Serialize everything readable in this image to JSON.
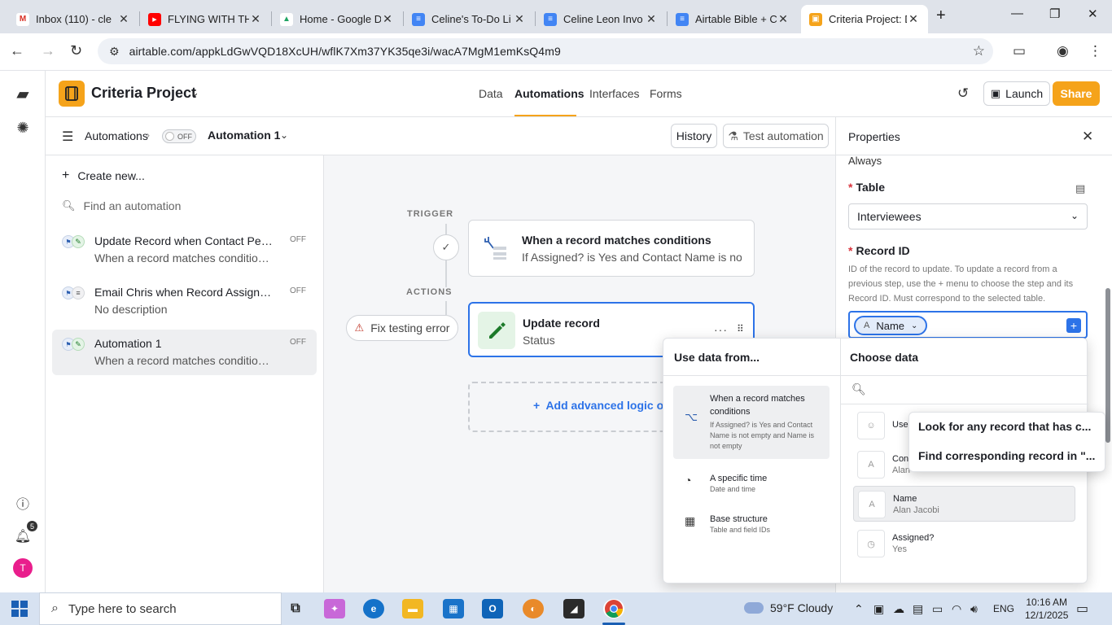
{
  "browser": {
    "tabs": [
      {
        "title": "Inbox (110) - cle",
        "favicon_color": "#d93025",
        "favicon_letter": "M"
      },
      {
        "title": "FLYING WITH TH",
        "favicon_color": "#ff0000",
        "favicon_letter": "▶"
      },
      {
        "title": "Home - Google D",
        "favicon_color": "#1fa463",
        "favicon_letter": "▲"
      },
      {
        "title": "Celine's To-Do Li",
        "favicon_color": "#4285f4",
        "favicon_letter": "≡"
      },
      {
        "title": "Celine Leon Invo",
        "favicon_color": "#4285f4",
        "favicon_letter": "≡"
      },
      {
        "title": "Airtable Bible + C",
        "favicon_color": "#4285f4",
        "favicon_letter": "≡"
      },
      {
        "title": "Criteria Project: D",
        "favicon_color": "#f5a31a",
        "favicon_letter": "▣"
      }
    ],
    "url": "airtable.com/appkLdGwVQD18XcUH/wflK7Xm37YK35qe3i/wacA7MgM1emKsQ4m9"
  },
  "rail": {
    "notification_count": "5",
    "avatar_letter": "T"
  },
  "header": {
    "base_name": "Criteria Project",
    "nav": [
      "Data",
      "Automations",
      "Interfaces",
      "Forms"
    ],
    "launch_label": "Launch",
    "share_label": "Share"
  },
  "subheader": {
    "crumb": "Automations",
    "toggle_label": "OFF",
    "automation_name": "Automation 1",
    "history_label": "History",
    "test_label": "Test automation"
  },
  "sidebar": {
    "create_label": "Create new...",
    "find_placeholder": "Find an automation",
    "items": [
      {
        "title": "Update Record when Contact Person...",
        "subtitle": "When a record matches conditions, f...",
        "status": "OFF"
      },
      {
        "title": "Email Chris when Record Assigned C...",
        "subtitle": "No description",
        "status": "OFF"
      },
      {
        "title": "Automation 1",
        "subtitle": "When a record matches conditions, ...",
        "status": "OFF"
      }
    ]
  },
  "canvas": {
    "trigger_label": "TRIGGER",
    "actions_label": "ACTIONS",
    "trigger_node": {
      "title": "When a record matches conditions",
      "subtitle": "If Assigned? is Yes and Contact Name is not ..."
    },
    "action_node": {
      "title": "Update record",
      "subtitle": "Status"
    },
    "fix_label": "Fix testing error",
    "add_logic_label": "Add advanced logic or a"
  },
  "properties": {
    "title": "Properties",
    "always_text": "Always",
    "table_label": "Table",
    "table_value": "Interviewees",
    "record_id_label": "Record ID",
    "record_id_help": "ID of the record to update. To update a record from a previous step, use the + menu to choose the step and its Record ID. Must correspond to the selected table.",
    "pill_label": "Name"
  },
  "picker": {
    "left_header": "Use data from...",
    "right_header": "Choose data",
    "sources": [
      {
        "title": "When a record matches conditions",
        "subtitle": "If Assigned? is Yes and Contact Name is not empty and Name is not empty"
      },
      {
        "title": "A specific time",
        "subtitle": "Date and time"
      },
      {
        "title": "Base structure",
        "subtitle": "Table and field IDs"
      }
    ],
    "fields": [
      {
        "title": "Use",
        "subtitle": ""
      },
      {
        "title": "Con",
        "subtitle": "Alan"
      },
      {
        "title": "Name",
        "subtitle": "Alan Jacobi"
      },
      {
        "title": "Assigned?",
        "subtitle": "Yes"
      }
    ]
  },
  "subpopup": {
    "options": [
      "Look for any record that has c...",
      "Find corresponding record in \"..."
    ]
  },
  "taskbar": {
    "search_placeholder": "Type here to search",
    "weather": "59°F  Cloudy",
    "lang": "ENG",
    "time": "10:16 AM",
    "date": "12/1/2025"
  }
}
